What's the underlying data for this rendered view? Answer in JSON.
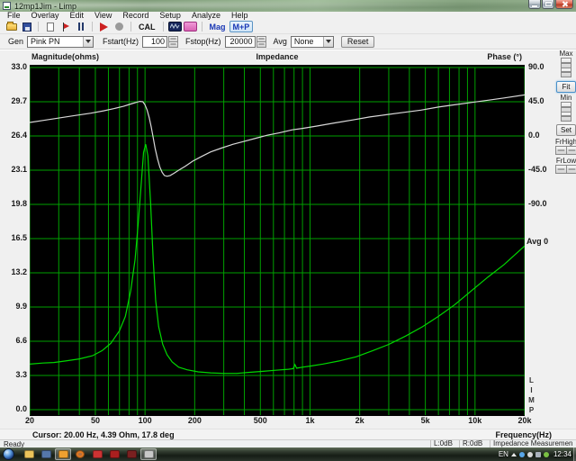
{
  "window": {
    "title": "12mp1Jim - Limp"
  },
  "menu": {
    "items": [
      "File",
      "Overlay",
      "Edit",
      "View",
      "Record",
      "Setup",
      "Analyze",
      "Help"
    ]
  },
  "toolbar": {
    "cal": "CAL",
    "mag": "Mag",
    "mp": "M+P"
  },
  "genbar": {
    "gen_label": "Gen",
    "generator": "Pink PN",
    "fstart_label": "Fstart(Hz)",
    "fstart": "100",
    "fstop_label": "Fstop(Hz)",
    "fstop": "20000",
    "avg_label": "Avg",
    "avg": "None",
    "reset": "Reset"
  },
  "chart": {
    "title": "Impedance",
    "magnitude_label": "Magnitude(ohms)",
    "phase_label": "Phase (°)",
    "frequency_label": "Frequency(Hz)",
    "avg_counter": "Avg 0",
    "watermark": "LIMP",
    "grid_color": "#00a000",
    "background": "#000000"
  },
  "chart_data": {
    "type": "line",
    "x_scale": "log",
    "x_range": [
      20,
      20000
    ],
    "x_tick_labels": [
      "20",
      "50",
      "100",
      "200",
      "500",
      "1k",
      "2k",
      "5k",
      "10k",
      "20k"
    ],
    "x_tick_values": [
      20,
      50,
      100,
      200,
      500,
      1000,
      2000,
      5000,
      10000,
      20000
    ],
    "x_grid_values": [
      20,
      30,
      40,
      50,
      60,
      70,
      80,
      90,
      100,
      200,
      300,
      400,
      500,
      600,
      700,
      800,
      900,
      1000,
      2000,
      3000,
      4000,
      5000,
      6000,
      7000,
      8000,
      9000,
      10000,
      20000
    ],
    "left_axis": {
      "label": "Magnitude(ohms)",
      "range": [
        0,
        33
      ],
      "ticks": [
        33.0,
        29.7,
        26.4,
        23.1,
        19.8,
        16.5,
        13.2,
        9.9,
        6.6,
        3.3,
        0.0
      ]
    },
    "right_axis": {
      "label": "Phase (°)",
      "ticks": [
        90.0,
        45.0,
        0.0,
        -45.0,
        -90.0
      ],
      "deg_per_division": 45
    },
    "cursor": {
      "freq_hz": 20.0,
      "magnitude_ohm": 4.39,
      "phase_deg": 17.8
    },
    "series": [
      {
        "name": "Impedance magnitude",
        "unit": "ohm",
        "color": "#00d800",
        "points": [
          [
            20,
            4.39
          ],
          [
            24,
            4.5
          ],
          [
            28,
            4.55
          ],
          [
            33,
            4.7
          ],
          [
            40,
            4.9
          ],
          [
            48,
            5.2
          ],
          [
            55,
            5.7
          ],
          [
            62,
            6.4
          ],
          [
            70,
            7.6
          ],
          [
            76,
            9.0
          ],
          [
            82,
            11.5
          ],
          [
            87,
            14.5
          ],
          [
            91,
            18.0
          ],
          [
            95,
            22.0
          ],
          [
            98,
            24.8
          ],
          [
            101,
            25.6
          ],
          [
            104,
            24.5
          ],
          [
            108,
            20.0
          ],
          [
            112,
            14.5
          ],
          [
            116,
            10.5
          ],
          [
            121,
            8.0
          ],
          [
            128,
            6.3
          ],
          [
            136,
            5.3
          ],
          [
            146,
            4.6
          ],
          [
            160,
            4.1
          ],
          [
            180,
            3.85
          ],
          [
            210,
            3.65
          ],
          [
            250,
            3.55
          ],
          [
            300,
            3.5
          ],
          [
            360,
            3.5
          ],
          [
            430,
            3.6
          ],
          [
            520,
            3.7
          ],
          [
            620,
            3.8
          ],
          [
            740,
            3.9
          ],
          [
            790,
            3.95
          ],
          [
            810,
            4.35
          ],
          [
            830,
            4.0
          ],
          [
            900,
            4.1
          ],
          [
            1000,
            4.2
          ],
          [
            1200,
            4.4
          ],
          [
            1500,
            4.7
          ],
          [
            1900,
            5.1
          ],
          [
            2400,
            5.7
          ],
          [
            3000,
            6.3
          ],
          [
            3800,
            7.1
          ],
          [
            4800,
            8.0
          ],
          [
            6000,
            9.0
          ],
          [
            7500,
            10.1
          ],
          [
            9400,
            11.4
          ],
          [
            12000,
            12.8
          ],
          [
            15000,
            14.0
          ],
          [
            20000,
            15.8
          ]
        ]
      },
      {
        "name": "Phase",
        "unit": "deg",
        "color": "#d8d8d8",
        "points": [
          [
            20,
            17.8
          ],
          [
            25,
            21
          ],
          [
            31,
            24
          ],
          [
            38,
            27
          ],
          [
            47,
            30
          ],
          [
            56,
            33
          ],
          [
            65,
            36
          ],
          [
            74,
            39
          ],
          [
            82,
            42
          ],
          [
            88,
            44
          ],
          [
            93,
            45.5
          ],
          [
            97,
            45
          ],
          [
            100,
            41
          ],
          [
            103,
            34
          ],
          [
            106,
            24
          ],
          [
            109,
            12
          ],
          [
            112,
            -2
          ],
          [
            115,
            -16
          ],
          [
            119,
            -30
          ],
          [
            123,
            -41
          ],
          [
            127,
            -48
          ],
          [
            131,
            -52
          ],
          [
            136,
            -53
          ],
          [
            142,
            -52
          ],
          [
            150,
            -49
          ],
          [
            160,
            -45
          ],
          [
            175,
            -40
          ],
          [
            195,
            -33
          ],
          [
            220,
            -27
          ],
          [
            250,
            -21
          ],
          [
            290,
            -16
          ],
          [
            340,
            -11
          ],
          [
            400,
            -7
          ],
          [
            470,
            -3
          ],
          [
            550,
            1
          ],
          [
            650,
            4
          ],
          [
            780,
            8
          ],
          [
            900,
            10
          ],
          [
            1100,
            13
          ],
          [
            1400,
            17
          ],
          [
            1800,
            21
          ],
          [
            2300,
            25
          ],
          [
            2900,
            28
          ],
          [
            3700,
            31
          ],
          [
            4700,
            34
          ],
          [
            6000,
            38
          ],
          [
            7500,
            41
          ],
          [
            9500,
            44
          ],
          [
            12000,
            47
          ],
          [
            15000,
            50
          ],
          [
            20000,
            54
          ]
        ]
      }
    ]
  },
  "side_panel": {
    "max": "Max",
    "fit": "Fit",
    "min": "Min",
    "set": "Set",
    "frhigh": "FrHigh",
    "frlow": "FrLow"
  },
  "cursor_bar": {
    "cursor": "Cursor: 20.00 Hz, 4.39 Ohm, 17.8 deg"
  },
  "status_bar": {
    "ready": "Ready",
    "l": "L:0dB",
    "r": "R:0dB",
    "mode": "Impedance Measuremen"
  },
  "taskbar": {
    "lang": "EN",
    "clock": "12:34",
    "icons": [
      {
        "name": "explorer-icon",
        "color": "#ecc35a",
        "active": false
      },
      {
        "name": "media-app-icon",
        "color": "#5577aa",
        "active": false
      },
      {
        "name": "image-app-icon",
        "color": "#f0a030",
        "active": true
      },
      {
        "name": "firefox-icon",
        "color": "#e07820",
        "active": false
      },
      {
        "name": "red-app-icon",
        "color": "#cc3333",
        "active": false
      },
      {
        "name": "acrobat-icon",
        "color": "#aa1f1f",
        "active": false
      },
      {
        "name": "corel-app-icon",
        "color": "#7a2020",
        "active": false
      },
      {
        "name": "limp-app-icon",
        "color": "#c8c8c8",
        "active": true
      }
    ]
  }
}
